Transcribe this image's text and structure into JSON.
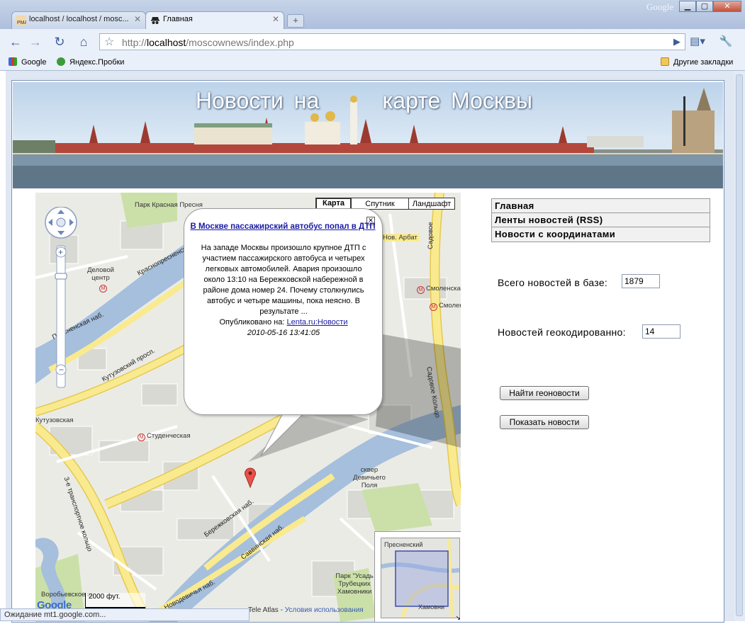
{
  "browser": {
    "tabs": [
      {
        "label": "localhost / localhost / mosc...",
        "icon": "phpmyadmin-icon",
        "active": false
      },
      {
        "label": "Главная",
        "icon": "spy-icon",
        "active": true
      }
    ],
    "window_brand": "Google",
    "address": {
      "prefix": "http://",
      "host": "localhost",
      "path": "/moscownews/index.php"
    },
    "bookmarks": [
      {
        "label": "Google",
        "icon": "google-icon"
      },
      {
        "label": "Яндекс.Пробки",
        "icon": "yandex-probki-icon"
      }
    ],
    "other_bookmarks": "Другие закладки",
    "status": "Ожидание mt1.google.com..."
  },
  "page": {
    "banner_title": "Новости на      карте Москвы",
    "menu": [
      "Главная",
      "Ленты новостей (RSS)",
      "Новости с координатами"
    ],
    "total_label": "Всего новостей в базе:",
    "total_value": "1879",
    "geocoded_label": "Новостей геокодированно:",
    "geocoded_value": "14",
    "find_button": "Найти геоновости",
    "show_button": "Показать новости"
  },
  "map": {
    "types": [
      "Карта",
      "Спутник",
      "Ландшафт"
    ],
    "active_type": "Карта",
    "infowindow": {
      "title": "В Москве пассажирский автобус попал в ДТП",
      "body": "На западе Москвы произошло крупное ДТП с участием пассажирского автобуса и четырех легковых автомобилей. Авария произошло около 13:10 на Бережковской набережной в районе дома номер 24. Почему столкнулись автобус и четыре машины, пока неясно. В результате ...",
      "published_label": "Опубликовано на:",
      "source": "Lenta.ru:Новости",
      "date": "2010-05-16 13:41:05"
    },
    "labels": {
      "park": "Парк Красная Пресня",
      "delovoy": "Деловой центр",
      "krasnopresn": "Краснопресненская наб.",
      "presnenskaya": "Пресненская наб.",
      "kutuz_prosp": "Кутузовский просп.",
      "kutuzovskaya": "Кутузовская",
      "studencheskaya": "Студенческая",
      "novarbat": "Нов. Арбат",
      "sadovoe1": "Садовое",
      "sadovoe2": "Садовое Кольцо",
      "smolensk1": "Смоленская",
      "smolensk2": "Смоленс",
      "third_ring": "3-е транспортное кольцо",
      "berezhk": "Бережковская наб.",
      "savvinskaya": "Саввинская наб.",
      "novodevichy": "Новодевичья наб.",
      "vorobyovskoe": "Воробьевское ш.",
      "devichy": "сквер Девичьего Поля",
      "park_usadba": "Парк \"Усадь Трубецких Хамовники",
      "ov_presnensky": "Пресненский",
      "ov_hamovniki": "Хамовни"
    },
    "scale_label": "2000 фут.",
    "copyright": "Tele Atlas - ",
    "terms": "Условия использования"
  },
  "colors": {
    "chrome": "#c6d4e8",
    "river": "#a5bfdd",
    "major_road": "#f9ea8f",
    "park": "#cbe0a8",
    "link": "#1a1aa5"
  }
}
